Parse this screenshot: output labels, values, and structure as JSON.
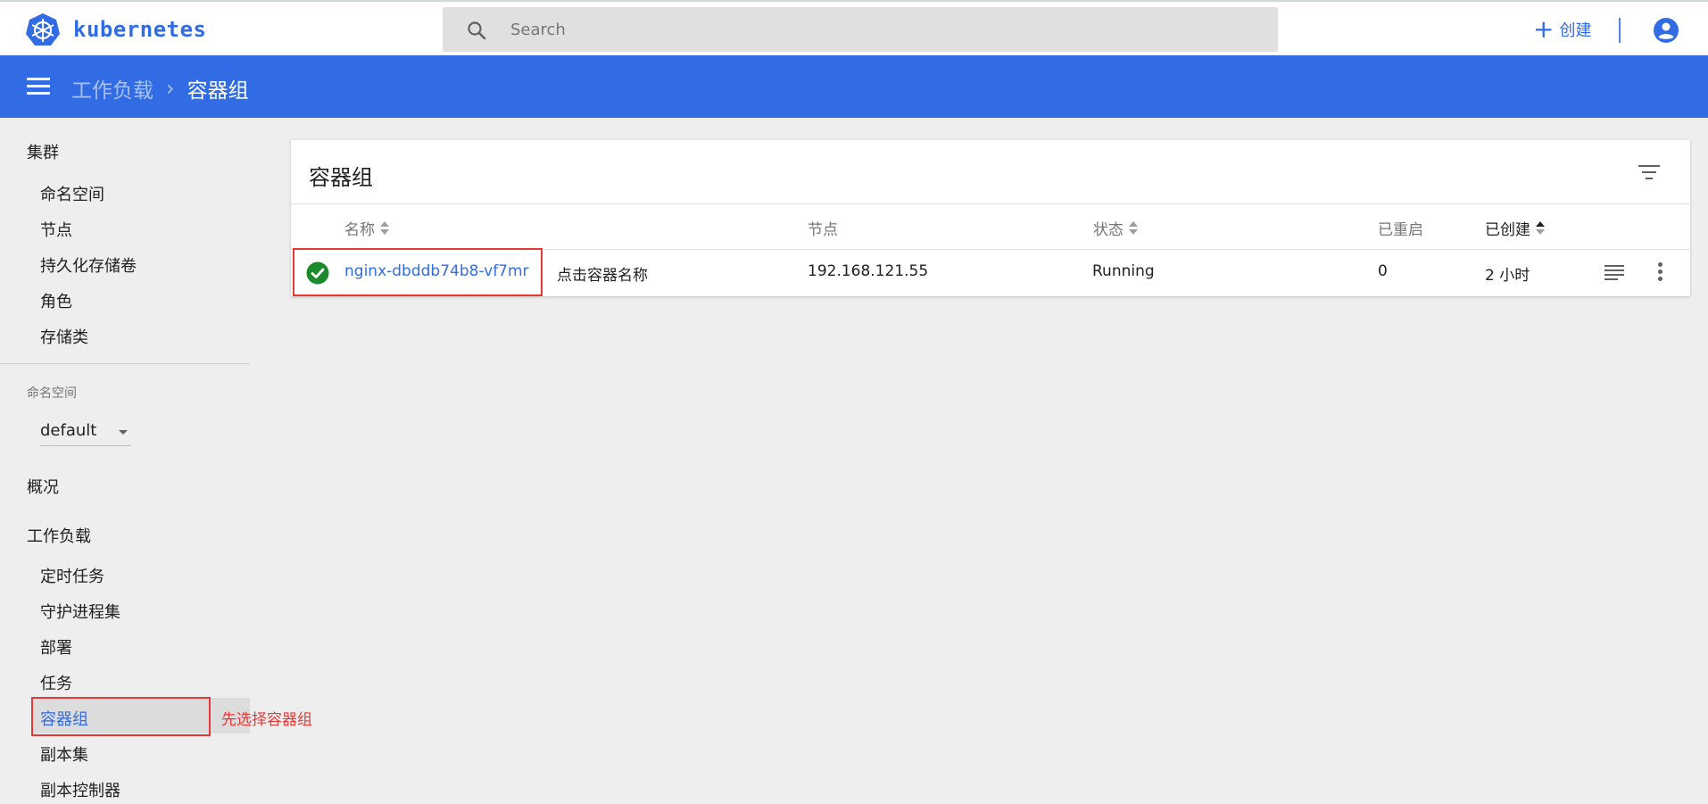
{
  "header": {
    "brand": "kubernetes",
    "search_placeholder": "Search",
    "create_label": "创建",
    "create_icon": "plus-icon",
    "user_icon": "account-circle-icon"
  },
  "breadcrumb": {
    "parent": "工作负载",
    "separator": "›",
    "current": "容器组"
  },
  "sidebar": {
    "cluster_heading": "集群",
    "cluster_items": [
      "命名空间",
      "节点",
      "持久化存储卷",
      "角色",
      "存储类"
    ],
    "namespace_label": "命名空间",
    "namespace_value": "default",
    "overview": "概况",
    "workloads_heading": "工作负载",
    "workload_items": [
      "定时任务",
      "守护进程集",
      "部署",
      "任务",
      "容器组",
      "副本集",
      "副本控制器"
    ],
    "active_item": "容器组",
    "annotation": "先选择容器组"
  },
  "card": {
    "title": "容器组",
    "columns": {
      "name": "名称",
      "node": "节点",
      "status": "状态",
      "restarts": "已重启",
      "created": "已创建"
    },
    "rows": [
      {
        "name": "nginx-dbddb74b8-vf7mr",
        "node": "192.168.121.55",
        "status": "Running",
        "restarts": "0",
        "created": "2 小时",
        "status_icon": "check-circle-icon"
      }
    ],
    "annotation": "点击容器名称"
  },
  "colors": {
    "accent": "#326ce5",
    "success": "#1b8a2a",
    "annotation": "#e53935"
  }
}
